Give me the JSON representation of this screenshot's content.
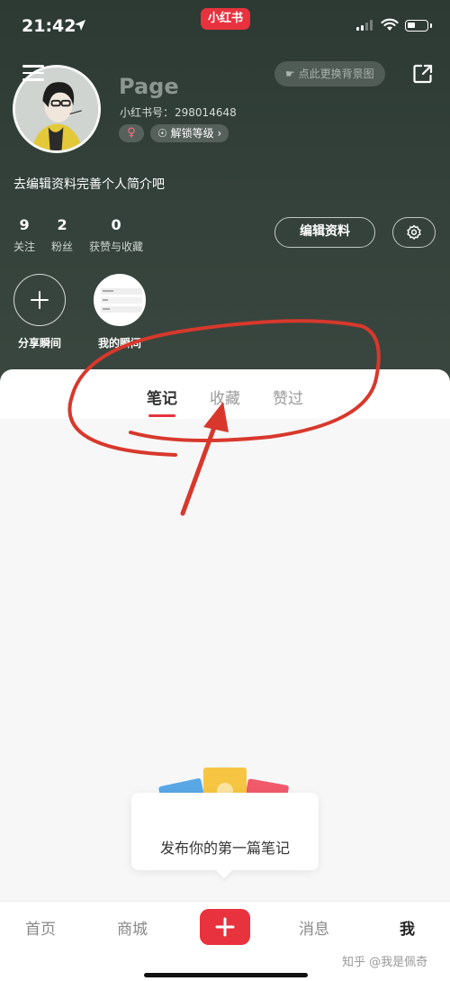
{
  "status_bar": {
    "time": "21:42",
    "app_logo": "小红书"
  },
  "profile": {
    "username": "Page",
    "id_label": "小红书号：",
    "id_value": "298014648",
    "gender_symbol": "♀",
    "level_badge": "解锁等级",
    "bg_change": "点此更换背景图",
    "bio": "去编辑资料完善个人简介吧",
    "edit_button": "编辑资料"
  },
  "stats": [
    {
      "value": "9",
      "label": "关注"
    },
    {
      "value": "2",
      "label": "粉丝"
    },
    {
      "value": "0",
      "label": "获赞与收藏"
    }
  ],
  "moments": {
    "share_label": "分享瞬间",
    "mine_label": "我的瞬间"
  },
  "tabs": [
    {
      "label": "笔记",
      "active": true
    },
    {
      "label": "收藏",
      "active": false
    },
    {
      "label": "赞过",
      "active": false
    }
  ],
  "empty_state": {
    "text": "发布你的第一篇笔记"
  },
  "bottom_nav": {
    "home": "首页",
    "mall": "商城",
    "messages": "消息",
    "me": "我"
  },
  "watermark": "知乎 @我是佩奇",
  "colors": {
    "brand_red": "#e8323e",
    "header_bg": "#34423b",
    "annotation_red": "#d8382c"
  },
  "icons": [
    "location-arrow-icon",
    "signal-icon",
    "wifi-icon",
    "battery-icon",
    "menu-icon",
    "share-icon",
    "gear-icon",
    "plus-icon"
  ]
}
